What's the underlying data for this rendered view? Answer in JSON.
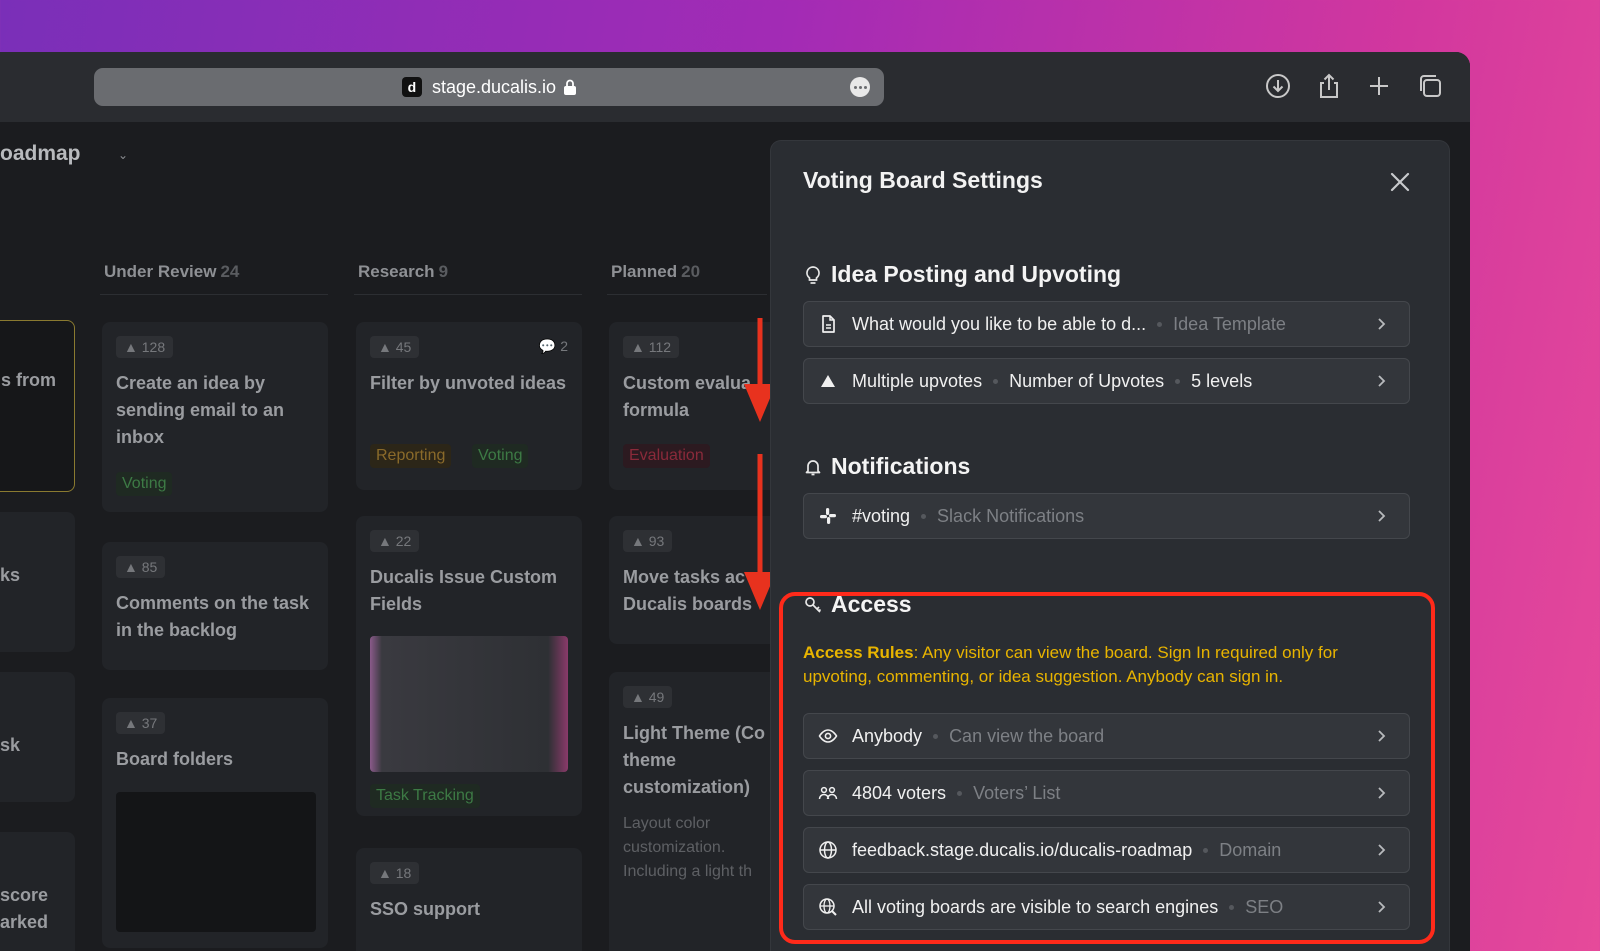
{
  "browser": {
    "favicon_letter": "d",
    "url": "stage.ducalis.io",
    "icons": [
      "download-icon",
      "share-icon",
      "new-tab-icon",
      "tabs-overview-icon"
    ]
  },
  "board": {
    "title": "oadmap",
    "columns": [
      {
        "name": "Under Review",
        "count": "24"
      },
      {
        "name": "Research",
        "count": "9"
      },
      {
        "name": "Planned",
        "count": "20"
      }
    ],
    "left_cards": [
      "s from",
      "ks",
      "sk",
      "score",
      "arked"
    ],
    "cards": {
      "ur1": {
        "votes": "128",
        "title": "Create an idea by sending email to an inbox",
        "tag": "Voting"
      },
      "ur2": {
        "votes": "85",
        "title": "Comments on the task in the backlog"
      },
      "ur3": {
        "votes": "37",
        "title": "Board folders"
      },
      "rs1": {
        "votes": "45",
        "comments": "2",
        "title": "Filter by unvoted ideas",
        "tags": [
          "Reporting",
          "Voting"
        ]
      },
      "rs2": {
        "votes": "22",
        "title": "Ducalis Issue Custom Fields",
        "tag": "Task Tracking"
      },
      "rs3": {
        "votes": "18",
        "title": "SSO support"
      },
      "pl1": {
        "votes": "112",
        "title": "Custom evalua formula",
        "tag": "Evaluation"
      },
      "pl2": {
        "votes": "93",
        "title": "Move tasks ac Ducalis boards"
      },
      "pl3": {
        "votes": "49",
        "title": "Light Theme (Co theme customization)",
        "desc": "Layout color customization. Including a light th"
      }
    }
  },
  "panel": {
    "title": "Voting Board Settings",
    "sections": {
      "idea": {
        "heading": "Idea Posting and Upvoting",
        "rows": [
          {
            "main": "What would you like to be able to d...",
            "muted": "Idea Template"
          },
          {
            "main": "Multiple upvotes",
            "mid": "Number of Upvotes",
            "value": "5 levels"
          }
        ]
      },
      "notifications": {
        "heading": "Notifications",
        "rows": [
          {
            "main": "#voting",
            "muted": "Slack Notifications"
          }
        ]
      },
      "access": {
        "heading": "Access",
        "rules_label": "Access Rules",
        "rules_text": ": Any visitor can view the board. Sign In required only for upvoting, commenting, or idea suggestion. Anybody can sign in.",
        "rows": [
          {
            "main": "Anybody",
            "muted": "Can view the board"
          },
          {
            "main": "4804 voters",
            "muted": "Voters’ List"
          },
          {
            "main": "feedback.stage.ducalis.io/ducalis-roadmap",
            "muted": "Domain"
          },
          {
            "main": "All voting boards are visible to search engines",
            "muted": "SEO"
          }
        ]
      }
    }
  },
  "colors": {
    "highlight": "#ff2a1a",
    "access_rules": "#e8b400",
    "arrow": "#e8321e"
  }
}
